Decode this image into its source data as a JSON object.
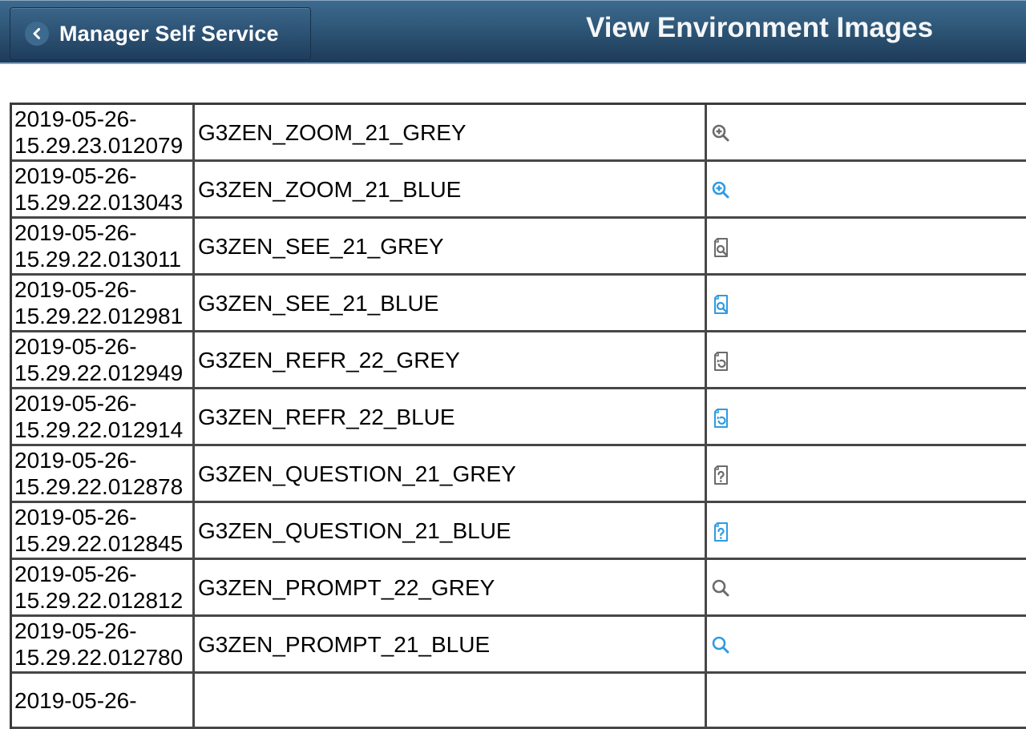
{
  "header": {
    "back_label": "Manager Self Service",
    "title": "View Environment Images"
  },
  "colors": {
    "header_bg": "#2e5676",
    "grey_icon": "#6b6b6b",
    "blue_icon": "#2f9be0"
  },
  "table": {
    "rows": [
      {
        "date": "2019-05-26-",
        "time": "15.29.23.012079",
        "name": "G3ZEN_ZOOM_21_GREY",
        "icon": "zoom-in-icon",
        "icon_color": "grey"
      },
      {
        "date": "2019-05-26-",
        "time": "15.29.22.013043",
        "name": "G3ZEN_ZOOM_21_BLUE",
        "icon": "zoom-in-icon",
        "icon_color": "blue"
      },
      {
        "date": "2019-05-26-",
        "time": "15.29.22.013011",
        "name": "G3ZEN_SEE_21_GREY",
        "icon": "document-search-icon",
        "icon_color": "grey"
      },
      {
        "date": "2019-05-26-",
        "time": "15.29.22.012981",
        "name": "G3ZEN_SEE_21_BLUE",
        "icon": "document-search-icon",
        "icon_color": "blue"
      },
      {
        "date": "2019-05-26-",
        "time": "15.29.22.012949",
        "name": "G3ZEN_REFR_22_GREY",
        "icon": "document-refresh-icon",
        "icon_color": "grey"
      },
      {
        "date": "2019-05-26-",
        "time": "15.29.22.012914",
        "name": "G3ZEN_REFR_22_BLUE",
        "icon": "document-refresh-icon",
        "icon_color": "blue"
      },
      {
        "date": "2019-05-26-",
        "time": "15.29.22.012878",
        "name": "G3ZEN_QUESTION_21_GREY",
        "icon": "document-question-icon",
        "icon_color": "grey"
      },
      {
        "date": "2019-05-26-",
        "time": "15.29.22.012845",
        "name": "G3ZEN_QUESTION_21_BLUE",
        "icon": "document-question-icon",
        "icon_color": "blue"
      },
      {
        "date": "2019-05-26-",
        "time": "15.29.22.012812",
        "name": "G3ZEN_PROMPT_22_GREY",
        "icon": "search-icon",
        "icon_color": "grey"
      },
      {
        "date": "2019-05-26-",
        "time": "15.29.22.012780",
        "name": "G3ZEN_PROMPT_21_BLUE",
        "icon": "search-icon",
        "icon_color": "blue"
      },
      {
        "date": "2019-05-26-",
        "time": "",
        "name": "",
        "icon": "",
        "icon_color": ""
      }
    ]
  }
}
